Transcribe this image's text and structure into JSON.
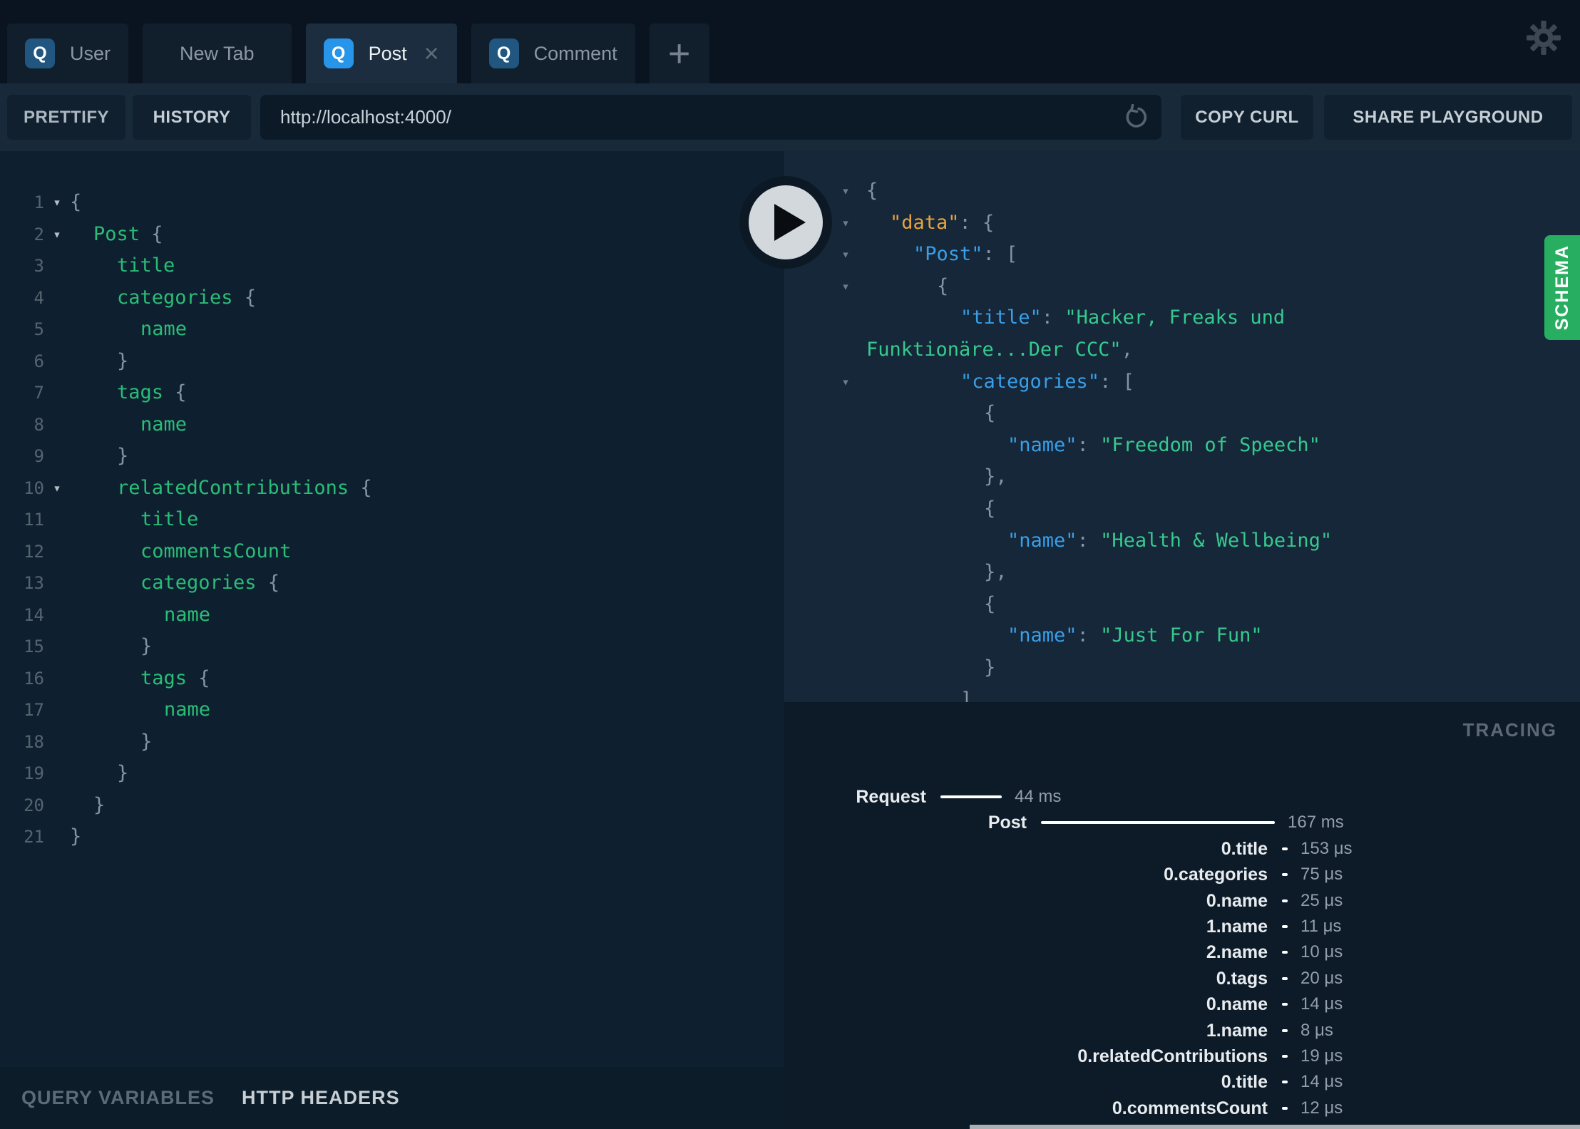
{
  "tabs": {
    "items": [
      {
        "label": "User",
        "badge": "Q",
        "active": false,
        "closable": false
      },
      {
        "label": "New Tab",
        "badge": null,
        "active": false,
        "closable": false
      },
      {
        "label": "Post",
        "badge": "Q",
        "active": true,
        "closable": true
      },
      {
        "label": "Comment",
        "badge": "Q",
        "active": false,
        "closable": false
      }
    ],
    "close_glyph": "×",
    "new_tab_button": "+"
  },
  "toolbar": {
    "prettify_label": "PRETTIFY",
    "history_label": "HISTORY",
    "url_value": "http://localhost:4000/",
    "copy_curl_label": "COPY CURL",
    "share_label": "SHARE PLAYGROUND"
  },
  "query_editor": {
    "fold_glyph": "▾",
    "lines": [
      {
        "n": 1,
        "fold": true,
        "ind": 0,
        "tokens": [
          [
            "pun",
            "{"
          ]
        ]
      },
      {
        "n": 2,
        "fold": true,
        "ind": 1,
        "tokens": [
          [
            "field",
            "Post"
          ],
          [
            "pun",
            " {"
          ]
        ]
      },
      {
        "n": 3,
        "fold": false,
        "ind": 2,
        "tokens": [
          [
            "field",
            "title"
          ]
        ]
      },
      {
        "n": 4,
        "fold": false,
        "ind": 2,
        "tokens": [
          [
            "field",
            "categories"
          ],
          [
            "pun",
            " {"
          ]
        ]
      },
      {
        "n": 5,
        "fold": false,
        "ind": 3,
        "tokens": [
          [
            "field",
            "name"
          ]
        ]
      },
      {
        "n": 6,
        "fold": false,
        "ind": 2,
        "tokens": [
          [
            "pun",
            "}"
          ]
        ]
      },
      {
        "n": 7,
        "fold": false,
        "ind": 2,
        "tokens": [
          [
            "field",
            "tags"
          ],
          [
            "pun",
            " {"
          ]
        ]
      },
      {
        "n": 8,
        "fold": false,
        "ind": 3,
        "tokens": [
          [
            "field",
            "name"
          ]
        ]
      },
      {
        "n": 9,
        "fold": false,
        "ind": 2,
        "tokens": [
          [
            "pun",
            "}"
          ]
        ]
      },
      {
        "n": 10,
        "fold": true,
        "ind": 2,
        "tokens": [
          [
            "field",
            "relatedContributions"
          ],
          [
            "pun",
            " {"
          ]
        ]
      },
      {
        "n": 11,
        "fold": false,
        "ind": 3,
        "tokens": [
          [
            "field",
            "title"
          ]
        ]
      },
      {
        "n": 12,
        "fold": false,
        "ind": 3,
        "tokens": [
          [
            "field",
            "commentsCount"
          ]
        ]
      },
      {
        "n": 13,
        "fold": false,
        "ind": 3,
        "tokens": [
          [
            "field",
            "categories"
          ],
          [
            "pun",
            " {"
          ]
        ]
      },
      {
        "n": 14,
        "fold": false,
        "ind": 4,
        "tokens": [
          [
            "field",
            "name"
          ]
        ]
      },
      {
        "n": 15,
        "fold": false,
        "ind": 3,
        "tokens": [
          [
            "pun",
            "}"
          ]
        ]
      },
      {
        "n": 16,
        "fold": false,
        "ind": 3,
        "tokens": [
          [
            "field",
            "tags"
          ],
          [
            "pun",
            " {"
          ]
        ]
      },
      {
        "n": 17,
        "fold": false,
        "ind": 4,
        "tokens": [
          [
            "field",
            "name"
          ]
        ]
      },
      {
        "n": 18,
        "fold": false,
        "ind": 3,
        "tokens": [
          [
            "pun",
            "}"
          ]
        ]
      },
      {
        "n": 19,
        "fold": false,
        "ind": 2,
        "tokens": [
          [
            "pun",
            "}"
          ]
        ]
      },
      {
        "n": 20,
        "fold": false,
        "ind": 1,
        "tokens": [
          [
            "pun",
            "}"
          ]
        ]
      },
      {
        "n": 21,
        "fold": false,
        "ind": 0,
        "tokens": [
          [
            "pun",
            "}"
          ]
        ]
      }
    ]
  },
  "response": {
    "fold_glyph": "▾",
    "lines": [
      {
        "fold": true,
        "ind": 0,
        "tokens": [
          [
            "pun",
            "{"
          ]
        ]
      },
      {
        "fold": true,
        "ind": 1,
        "tokens": [
          [
            "data",
            "\"data\""
          ],
          [
            "pun",
            ": {"
          ]
        ]
      },
      {
        "fold": true,
        "ind": 2,
        "tokens": [
          [
            "key",
            "\"Post\""
          ],
          [
            "pun",
            ": ["
          ]
        ]
      },
      {
        "fold": true,
        "ind": 3,
        "tokens": [
          [
            "pun",
            "{"
          ]
        ]
      },
      {
        "fold": false,
        "ind": 4,
        "tokens": [
          [
            "key",
            "\"title\""
          ],
          [
            "pun",
            ": "
          ],
          [
            "str",
            "\"Hacker, Freaks und"
          ]
        ]
      },
      {
        "fold": false,
        "ind": 0,
        "tokens": [
          [
            "str",
            "Funktionäre...Der CCC\""
          ],
          [
            "pun",
            ","
          ]
        ]
      },
      {
        "fold": true,
        "ind": 4,
        "tokens": [
          [
            "key",
            "\"categories\""
          ],
          [
            "pun",
            ": ["
          ]
        ]
      },
      {
        "fold": false,
        "ind": 5,
        "tokens": [
          [
            "pun",
            "{"
          ]
        ]
      },
      {
        "fold": false,
        "ind": 6,
        "tokens": [
          [
            "key",
            "\"name\""
          ],
          [
            "pun",
            ": "
          ],
          [
            "str",
            "\"Freedom of Speech\""
          ]
        ]
      },
      {
        "fold": false,
        "ind": 5,
        "tokens": [
          [
            "pun",
            "},"
          ]
        ]
      },
      {
        "fold": false,
        "ind": 5,
        "tokens": [
          [
            "pun",
            "{"
          ]
        ]
      },
      {
        "fold": false,
        "ind": 6,
        "tokens": [
          [
            "key",
            "\"name\""
          ],
          [
            "pun",
            ": "
          ],
          [
            "str",
            "\"Health & Wellbeing\""
          ]
        ]
      },
      {
        "fold": false,
        "ind": 5,
        "tokens": [
          [
            "pun",
            "},"
          ]
        ]
      },
      {
        "fold": false,
        "ind": 5,
        "tokens": [
          [
            "pun",
            "{"
          ]
        ]
      },
      {
        "fold": false,
        "ind": 6,
        "tokens": [
          [
            "key",
            "\"name\""
          ],
          [
            "pun",
            ": "
          ],
          [
            "str",
            "\"Just For Fun\""
          ]
        ]
      },
      {
        "fold": false,
        "ind": 5,
        "tokens": [
          [
            "pun",
            "}"
          ]
        ]
      },
      {
        "fold": false,
        "ind": 4,
        "tokens": [
          [
            "pun",
            "]"
          ]
        ]
      }
    ]
  },
  "tracing": {
    "title": "TRACING",
    "rows": [
      {
        "label": "Request",
        "time": "44 ms",
        "bar": 86,
        "end": 199
      },
      {
        "label": "Post",
        "time": "167 ms",
        "bar": 328,
        "end": 340
      },
      {
        "label": "0.title",
        "time": "153 μs",
        "bar": 8,
        "end": 678
      },
      {
        "label": "0.categories",
        "time": "75 μs",
        "bar": 8,
        "end": 678
      },
      {
        "label": "0.name",
        "time": "25 μs",
        "bar": 8,
        "end": 678
      },
      {
        "label": "1.name",
        "time": "11 μs",
        "bar": 8,
        "end": 678
      },
      {
        "label": "2.name",
        "time": "10 μs",
        "bar": 8,
        "end": 678
      },
      {
        "label": "0.tags",
        "time": "20 μs",
        "bar": 8,
        "end": 678
      },
      {
        "label": "0.name",
        "time": "14 μs",
        "bar": 8,
        "end": 678
      },
      {
        "label": "1.name",
        "time": "8 μs",
        "bar": 8,
        "end": 678
      },
      {
        "label": "0.relatedContributions",
        "time": "19 μs",
        "bar": 8,
        "end": 678
      },
      {
        "label": "0.title",
        "time": "14 μs",
        "bar": 8,
        "end": 678
      },
      {
        "label": "0.commentsCount",
        "time": "12 μs",
        "bar": 8,
        "end": 678
      }
    ]
  },
  "bottom_bar": {
    "query_variables_label": "QUERY VARIABLES",
    "http_headers_label": "HTTP HEADERS"
  },
  "schema_tab": {
    "label": "SCHEMA"
  },
  "colors": {
    "accent_key_blue": "#399fe8",
    "query_field_green": "#2abd76",
    "string_green": "#36c98e",
    "data_key_orange": "#e8a33c",
    "schema_green": "#27ae60",
    "active_badge_blue": "#2795e9",
    "muted_badge_blue": "#20567f",
    "play_button_face": "#d3d8dc"
  }
}
